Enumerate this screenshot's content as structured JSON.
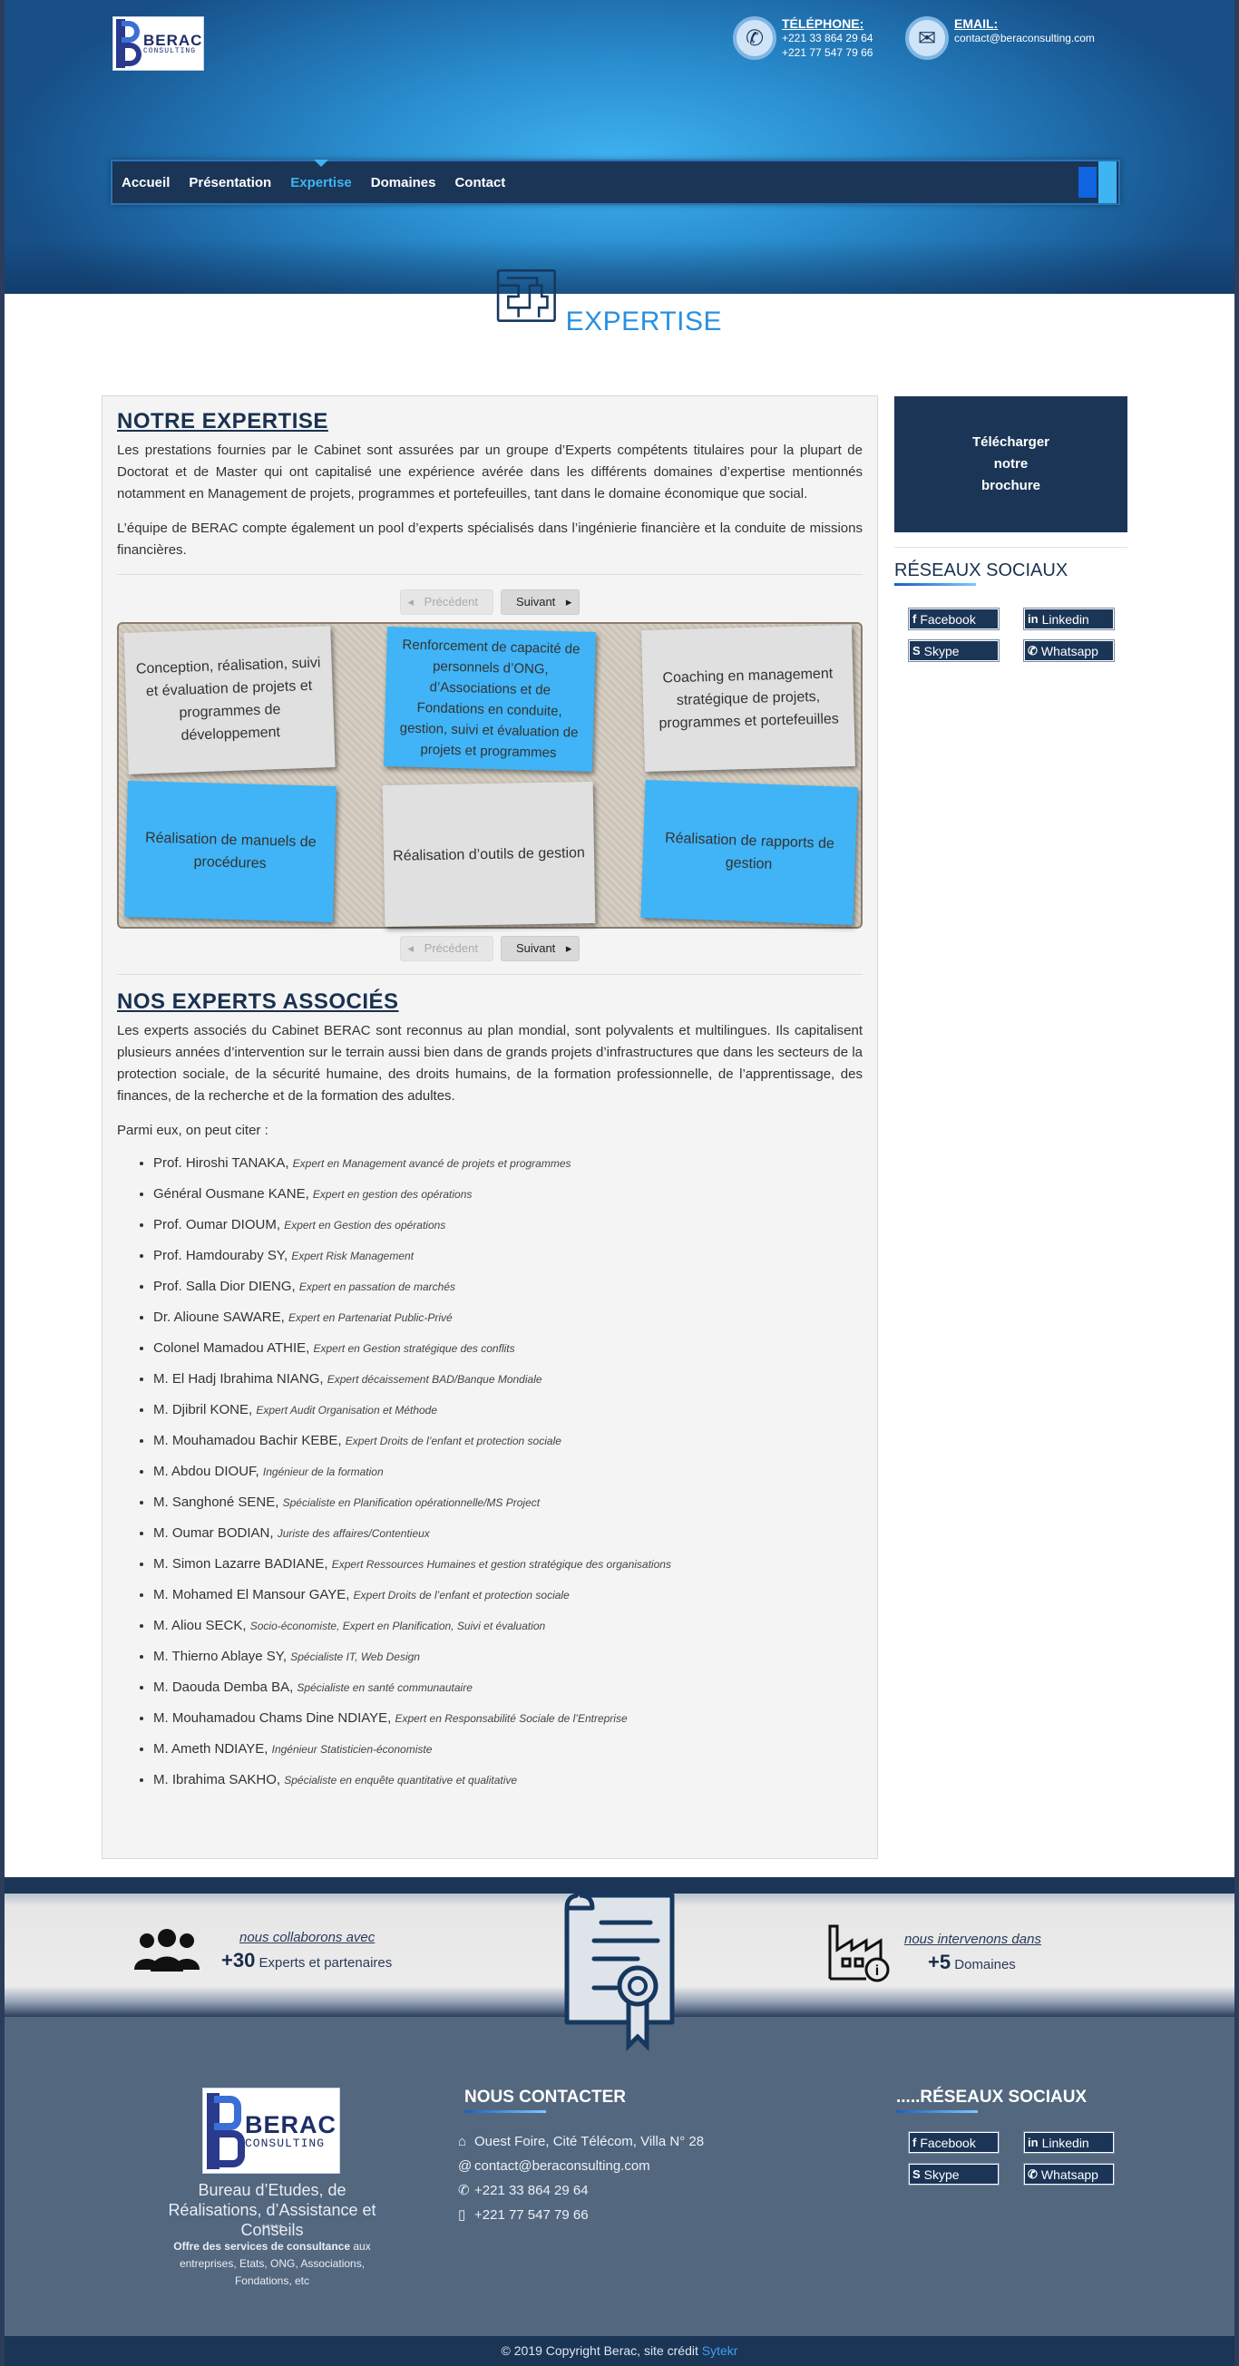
{
  "brand": {
    "logo_main": "BERAC",
    "logo_sub": "CONSULTING"
  },
  "header": {
    "phone_label": "TÉLÉPHONE:",
    "phone_1": "+221 33 864 29 64",
    "phone_2": "+221 77 547 79 66",
    "email_label": "EMAIL:",
    "email": "contact@beraconsulting.com"
  },
  "nav": {
    "items": [
      {
        "label": "Accueil",
        "active": false
      },
      {
        "label": "Présentation",
        "active": false
      },
      {
        "label": "Expertise",
        "active": true
      },
      {
        "label": "Domaines",
        "active": false
      },
      {
        "label": "Contact",
        "active": false
      }
    ]
  },
  "hero": {
    "title": "EXPERTISE",
    "icon": "maze-icon"
  },
  "expertise": {
    "title": "NOTRE EXPERTISE",
    "para1": "Les prestations fournies par le Cabinet sont assurées par un groupe d’Experts compétents titulaires pour la plupart de Doctorat et de Master qui ont capitalisé une expérience avérée dans les différents domaines d’expertise mentionnés notamment en Management de projets, programmes et portefeuilles, tant dans le domaine économique que social.",
    "para2": "L’équipe de BERAC compte également un pool d’experts spécialisés dans l’ingénierie financière et la conduite de missions financières.",
    "prev_label": "Précédent",
    "next_label": "Suivant",
    "notes": [
      {
        "text": "Conception, réalisation, suivi et évaluation de projets et programmes de développement",
        "color": "grey"
      },
      {
        "text": "Renforcement de capacité de personnels d’ONG, d’Associations et de Fondations en conduite, gestion, suivi et évaluation de projets et programmes",
        "color": "blue"
      },
      {
        "text": "Coaching en management stratégique de projets, programmes et portefeuilles",
        "color": "grey"
      },
      {
        "text": "Réalisation de manuels de procédures",
        "color": "blue"
      },
      {
        "text": "Réalisation d’outils de gestion",
        "color": "grey"
      },
      {
        "text": "Réalisation de rapports de gestion",
        "color": "blue"
      }
    ]
  },
  "experts": {
    "title": "NOS EXPERTS ASSOCIÉS",
    "para": "Les experts associés du Cabinet BERAC sont reconnus au plan mondial, sont polyvalents et multilingues. Ils capitalisent plusieurs années d’intervention sur le terrain aussi bien dans de grands projets d’infrastructures que dans les secteurs de la protection sociale, de la sécurité humaine, des droits humains, de la formation professionnelle, de l’apprentissage, des finances, de la recherche et de la formation des adultes.",
    "intro": "Parmi eux, on peut citer :",
    "list": [
      {
        "name": "Prof. Hiroshi TANAKA,",
        "role": "Expert en Management avancé de projets et programmes"
      },
      {
        "name": "Général Ousmane KANE,",
        "role": "Expert en gestion des opérations"
      },
      {
        "name": "Prof. Oumar DIOUM,",
        "role": "Expert en Gestion des opérations"
      },
      {
        "name": "Prof. Hamdouraby SY,",
        "role": "Expert Risk Management"
      },
      {
        "name": "Prof. Salla Dior DIENG,",
        "role": "Expert en passation de marchés"
      },
      {
        "name": "Dr. Alioune SAWARE,",
        "role": "Expert en Partenariat Public-Privé"
      },
      {
        "name": "Colonel Mamadou ATHIE,",
        "role": "Expert en Gestion stratégique des conflits"
      },
      {
        "name": "M. El Hadj Ibrahima NIANG,",
        "role": "Expert décaissement BAD/Banque Mondiale"
      },
      {
        "name": "M. Djibril KONE,",
        "role": "Expert Audit Organisation et Méthode"
      },
      {
        "name": "M. Mouhamadou Bachir KEBE,",
        "role": "Expert Droits de l’enfant et protection sociale"
      },
      {
        "name": "M. Abdou DIOUF,",
        "role": "Ingénieur de la formation"
      },
      {
        "name": "M. Sanghoné SENE,",
        "role": "Spécialiste en Planification opérationnelle/MS Project"
      },
      {
        "name": "M. Oumar BODIAN,",
        "role": "Juriste des affaires/Contentieux"
      },
      {
        "name": "M. Simon Lazarre BADIANE,",
        "role": "Expert Ressources Humaines et gestion stratégique des organisations"
      },
      {
        "name": "M. Mohamed El Mansour GAYE,",
        "role": "Expert Droits de l’enfant et protection sociale"
      },
      {
        "name": "M. Aliou SECK,",
        "role": "Socio-économiste, Expert en Planification, Suivi et évaluation"
      },
      {
        "name": "M. Thierno Ablaye SY,",
        "role": "Spécialiste IT, Web Design"
      },
      {
        "name": "M. Daouda Demba BA,",
        "role": "Spécialiste en santé communautaire"
      },
      {
        "name": "M. Mouhamadou Chams Dine NDIAYE,",
        "role": "Expert en Responsabilité Sociale de l’Entreprise"
      },
      {
        "name": "M. Ameth NDIAYE,",
        "role": "Ingénieur Statisticien-économiste"
      },
      {
        "name": "M. Ibrahima SAKHO,",
        "role": "Spécialiste en enquête quantitative et qualitative"
      }
    ]
  },
  "sidebar": {
    "brochure": [
      "Télécharger",
      "notre",
      "brochure"
    ],
    "social_title": "RÉSEAUX SOCIAUX",
    "social": [
      {
        "label": "Facebook",
        "icon": "facebook-icon",
        "glyph": "f"
      },
      {
        "label": "Linkedin",
        "icon": "linkedin-icon",
        "glyph": "in"
      },
      {
        "label": "Skype",
        "icon": "skype-icon",
        "glyph": "S"
      },
      {
        "label": "Whatsapp",
        "icon": "whatsapp-icon",
        "glyph": "✆"
      }
    ]
  },
  "stats": {
    "left_label": "nous collaborons avec",
    "left_value": "+30",
    "left_suffix": "Experts et partenaires",
    "right_label": "nous intervenons dans",
    "right_value": "+5",
    "right_suffix": "Domaines"
  },
  "footer": {
    "tagline": "Bureau d’Etudes, de Réalisations, d’Assistance et Conseils",
    "stars": "*****",
    "offer_bold": "Offre des services de consultance",
    "offer_rest": " aux entreprises, Etats, ONG, Associations, Fondations, etc",
    "contact_title": "NOUS CONTACTER",
    "address": "Ouest Foire, Cité Télécom, Villa N° 28",
    "email": "contact@beraconsulting.com",
    "phone_1": "+221 33 864 29 64",
    "phone_2": "+221 77 547 79 66",
    "social_title": ".....RÉSEAUX SOCIAUX",
    "copyright": "© 2019 Copyright Berac, site crédit ",
    "credit_link": "Sytekr"
  },
  "colors": {
    "navy": "#1b3556",
    "accent_blue": "#40b4f6",
    "footer_bg": "#53677f"
  }
}
